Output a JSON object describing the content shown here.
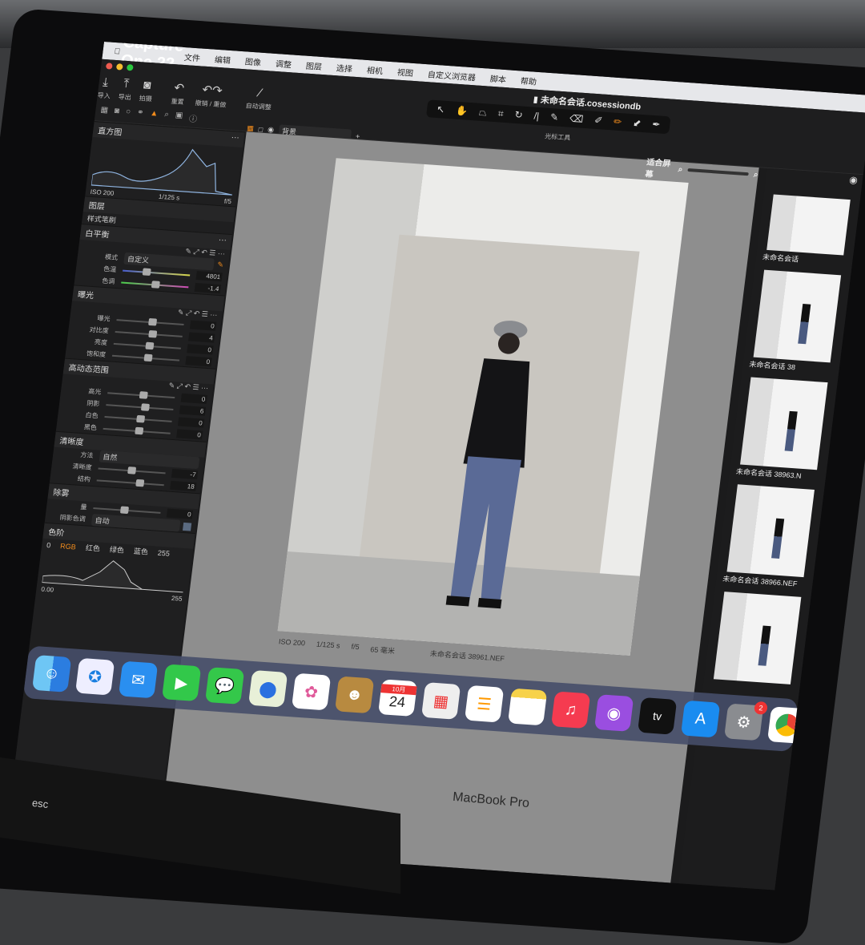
{
  "menubar": {
    "app": "Capture One 22",
    "items": [
      "文件",
      "编辑",
      "图像",
      "调整",
      "图层",
      "选择",
      "相机",
      "视图",
      "自定义浏览器",
      "脚本",
      "帮助"
    ]
  },
  "toolbar": {
    "buttons": [
      "导入",
      "导出",
      "拍摄",
      "重置",
      "撤销 / 重做",
      "自动调整"
    ],
    "document_title": "未命名会话.cosessiondb",
    "cursor_tools_label": "光标工具",
    "view_select": "背景"
  },
  "histogram": {
    "title": "直方图",
    "iso": "ISO 200",
    "shutter": "1/125 s",
    "aperture": "f/5"
  },
  "layers": {
    "title": "图层",
    "brush": "样式笔刷"
  },
  "white_balance": {
    "title": "白平衡",
    "mode_label": "模式",
    "mode": "自定义",
    "kelvin_label": "色温",
    "kelvin": "4801",
    "tint_label": "色调",
    "tint": "-1.4"
  },
  "exposure": {
    "title": "曝光",
    "rows": [
      {
        "label": "曝光",
        "value": "0"
      },
      {
        "label": "对比度",
        "value": "4"
      },
      {
        "label": "亮度",
        "value": "0"
      },
      {
        "label": "饱和度",
        "value": "0"
      }
    ]
  },
  "hdr": {
    "title": "高动态范围",
    "rows": [
      {
        "label": "高光",
        "value": "0"
      },
      {
        "label": "阴影",
        "value": "6"
      },
      {
        "label": "白色",
        "value": "0"
      },
      {
        "label": "黑色",
        "value": "0"
      }
    ]
  },
  "clarity": {
    "title": "清晰度",
    "method_label": "方法",
    "method": "自然",
    "rows": [
      {
        "label": "清晰度",
        "value": "-7"
      },
      {
        "label": "结构",
        "value": "18"
      }
    ]
  },
  "dehaze": {
    "title": "除雾",
    "amount_label": "量",
    "amount": "0",
    "shadow_label": "阴影色调",
    "shadow": "自动"
  },
  "levels": {
    "title": "色阶",
    "tabs": [
      "RGB",
      "红色",
      "绿色",
      "蓝色"
    ],
    "low": "0",
    "high": "255",
    "low_out": "0.00",
    "high_out": "255"
  },
  "viewer": {
    "zoom_label": "适合屏幕",
    "exif": {
      "iso": "ISO 200",
      "shutter": "1/125 s",
      "aperture": "f/5",
      "focal": "65 毫米",
      "filename": "未命名会话 38961.NEF"
    }
  },
  "filmstrip": [
    "未命名会话",
    "未命名会话 38",
    "未命名会话 38963.N",
    "未命名会话 38966.NEF"
  ],
  "dock": {
    "calendar_month": "10月",
    "calendar_day": "24",
    "settings_badge": "2",
    "tv": "tv"
  },
  "device": {
    "brand": "MacBook Pro",
    "esc": "esc"
  },
  "colors": {
    "accent": "#f28c1c",
    "menubar": "#e6e7ea",
    "panel": "#1f1f20"
  }
}
